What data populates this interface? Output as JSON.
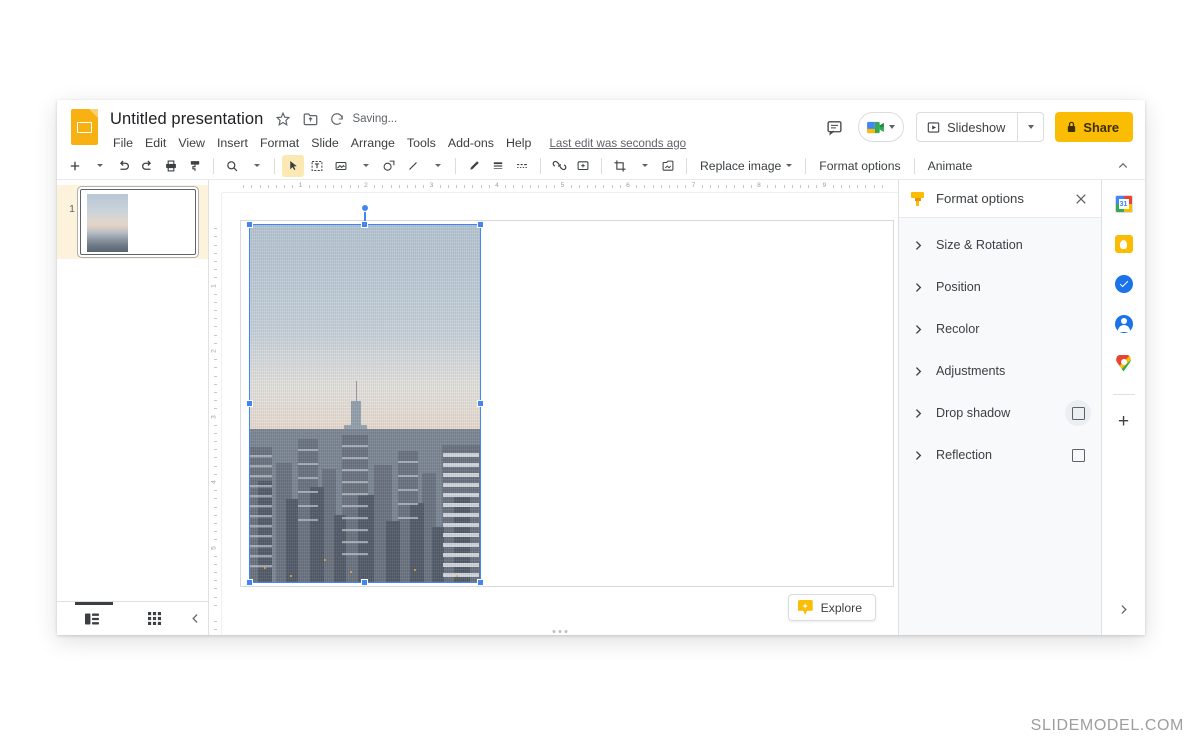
{
  "app": {
    "logo": "slides-logo",
    "doc_title": "Untitled presentation",
    "saving_status": "Saving...",
    "last_edit": "Last edit was seconds ago",
    "star_icon": "star-icon",
    "move_icon": "move-to-folder-icon",
    "cloud_icon": "cloud-sync-icon"
  },
  "menus": [
    {
      "label": "File"
    },
    {
      "label": "Edit"
    },
    {
      "label": "View"
    },
    {
      "label": "Insert"
    },
    {
      "label": "Format"
    },
    {
      "label": "Slide"
    },
    {
      "label": "Arrange"
    },
    {
      "label": "Tools"
    },
    {
      "label": "Add-ons"
    },
    {
      "label": "Help"
    }
  ],
  "header_right": {
    "comment_icon": "comment-icon",
    "meet_icon": "google-meet-icon",
    "slideshow_label": "Slideshow",
    "slideshow_icon": "present-icon",
    "share_label": "Share",
    "share_lock_icon": "lock-icon"
  },
  "toolbar": {
    "items": [
      {
        "name": "new-slide-button",
        "icon": "plus-icon",
        "caret": true,
        "active": false
      },
      {
        "name": "undo-button",
        "icon": "undo-icon",
        "caret": false,
        "active": false
      },
      {
        "name": "redo-button",
        "icon": "redo-icon",
        "caret": false,
        "active": false
      },
      {
        "name": "print-button",
        "icon": "printer-icon",
        "caret": false,
        "active": false
      },
      {
        "name": "paint-format-button",
        "icon": "paint-format-icon",
        "caret": false,
        "active": false
      },
      {
        "name": "zoom-button",
        "icon": "magnifier-icon",
        "caret": true,
        "active": false
      },
      {
        "name": "select-tool-button",
        "icon": "cursor-arrow-icon",
        "caret": false,
        "active": true
      },
      {
        "name": "text-box-button",
        "icon": "text-box-icon",
        "caret": false,
        "active": false
      },
      {
        "name": "insert-image-button",
        "icon": "image-icon",
        "caret": true,
        "active": false
      },
      {
        "name": "shape-button",
        "icon": "shape-icon",
        "caret": false,
        "active": false
      },
      {
        "name": "line-button",
        "icon": "line-icon",
        "caret": true,
        "active": false
      },
      {
        "name": "border-color-button",
        "icon": "pen-icon",
        "caret": false,
        "active": false
      },
      {
        "name": "border-weight-button",
        "icon": "line-weight-icon",
        "caret": false,
        "active": false
      },
      {
        "name": "border-dash-button",
        "icon": "line-dash-icon",
        "caret": false,
        "active": false
      },
      {
        "name": "insert-link-button",
        "icon": "link-icon",
        "caret": false,
        "active": false
      },
      {
        "name": "add-comment-button",
        "icon": "add-comment-icon",
        "caret": false,
        "active": false
      },
      {
        "name": "crop-image-button",
        "icon": "crop-icon",
        "caret": true,
        "active": false
      },
      {
        "name": "mask-image-button",
        "icon": "mask-image-icon",
        "caret": false,
        "active": false
      }
    ],
    "replace_image_label": "Replace image",
    "format_options_label": "Format options",
    "animate_label": "Animate",
    "collapse_icon": "chevron-up-icon"
  },
  "filmstrip": {
    "slides": [
      {
        "number": "1",
        "selected": true
      }
    ],
    "filmstrip_view_icon": "filmstrip-view-icon",
    "grid_view_icon": "grid-view-icon",
    "collapse_icon": "chevron-left-icon"
  },
  "rulers": {
    "horizontal_labels": [
      "1",
      "2",
      "3",
      "4",
      "5",
      "6",
      "7",
      "8",
      "9"
    ],
    "vertical_labels": [
      "1",
      "2",
      "3",
      "4",
      "5"
    ]
  },
  "canvas": {
    "explore_label": "Explore",
    "explore_icon": "explore-icon",
    "speaker_notes_handle": "drag-handle",
    "selected_object": "image-empire-state-building-new-york-skyline",
    "selection_color": "#4285f4"
  },
  "format_panel": {
    "title": "Format options",
    "icon": "paint-roller-icon",
    "close_icon": "close-icon",
    "rows": [
      {
        "label": "Size & Rotation",
        "name": "size-rotation",
        "has_checkbox": false,
        "checked": false,
        "hovered": false
      },
      {
        "label": "Position",
        "name": "position",
        "has_checkbox": false,
        "checked": false,
        "hovered": false
      },
      {
        "label": "Recolor",
        "name": "recolor",
        "has_checkbox": false,
        "checked": false,
        "hovered": false
      },
      {
        "label": "Adjustments",
        "name": "adjustments",
        "has_checkbox": false,
        "checked": false,
        "hovered": false
      },
      {
        "label": "Drop shadow",
        "name": "drop-shadow",
        "has_checkbox": true,
        "checked": false,
        "hovered": true
      },
      {
        "label": "Reflection",
        "name": "reflection",
        "has_checkbox": true,
        "checked": false,
        "hovered": false
      }
    ]
  },
  "side_rail": {
    "icons": [
      {
        "name": "google-calendar-icon",
        "day": "31"
      },
      {
        "name": "google-keep-icon"
      },
      {
        "name": "google-tasks-icon"
      },
      {
        "name": "google-contacts-icon"
      },
      {
        "name": "google-maps-icon"
      }
    ],
    "add_addon_icon": "plus-icon",
    "expand_icon": "chevron-right-icon"
  },
  "watermark": "SLIDEMODEL.COM",
  "colors": {
    "accent_yellow": "#fbbc04",
    "selection_blue": "#4285f4",
    "panel_bg": "#f8f9fa",
    "text_primary": "#3c4043",
    "text_secondary": "#5f6368"
  }
}
